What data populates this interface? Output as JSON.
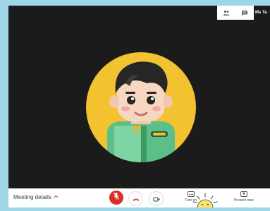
{
  "header": {
    "participant_name": "Ms Ta"
  },
  "bottom_bar": {
    "meeting_details_label": "Meeting details",
    "turn_on_label": "Turn on",
    "present_now_label": "Present now"
  },
  "icons": {
    "people": "people-icon",
    "chat": "chat-icon",
    "mic_off": "mic-off-icon",
    "hangup": "phone-hangup-icon",
    "camera": "camera-icon",
    "captions": "captions-icon",
    "present": "present-icon",
    "chevron": "chevron-up-icon"
  },
  "colors": {
    "mic_off_bg": "#d93025",
    "video_bg": "#1b1b1b",
    "avatar_bg": "#f2c230"
  }
}
